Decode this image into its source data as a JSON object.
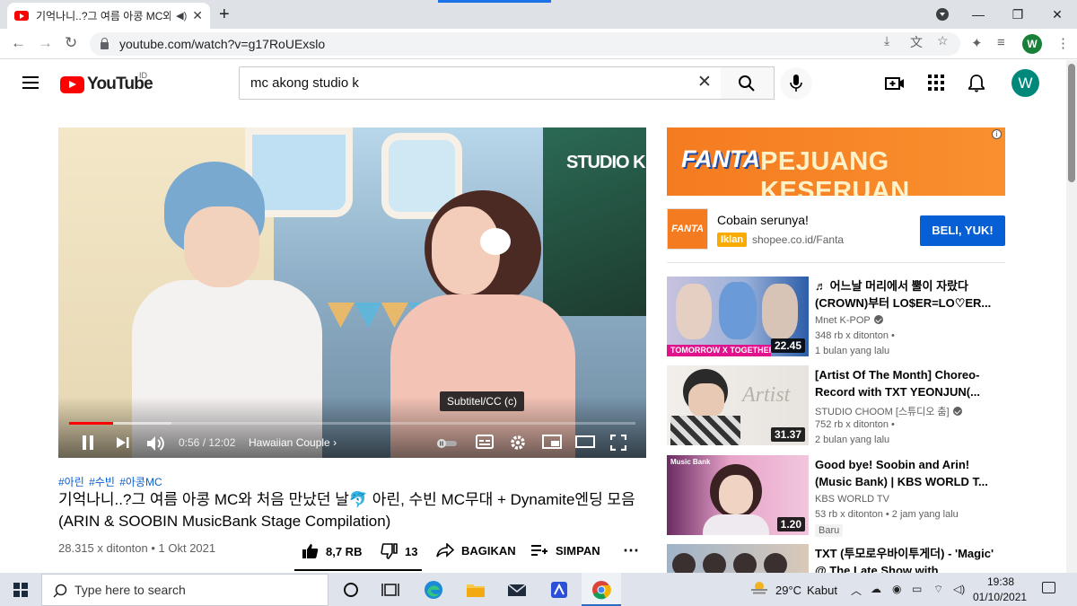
{
  "browser": {
    "tab_title": "기억나니..?그 여름 아콩 MC와 처음 만났던 날",
    "new_tab_symbol": "+",
    "url": "youtube.com/watch?v=g17RoUExslo",
    "profile_initial": "W",
    "window_controls": {
      "minimize": "—",
      "restore": "❐",
      "close": "✕"
    }
  },
  "masthead": {
    "logo_text": "YouTube",
    "country_code": "ID",
    "search_query": "mc akong studio k",
    "avatar_initial": "W"
  },
  "player": {
    "overlay_logo": "STUDIO K",
    "tooltip": "Subtitel/CC (c)",
    "time_current": "0:56",
    "time_total": "12:02",
    "time_display": "0:56 / 12:02",
    "chapter": "Hawaiian Couple",
    "progress_played": 0.078,
    "progress_loaded": 0.18
  },
  "video": {
    "hashtags": [
      "#아린",
      "#수빈",
      "#아콩MC"
    ],
    "title": "기억나니..?그 여름 아콩 MC와 처음 만났던 날🐬 아린, 수빈 MC무대 + Dynamite엔딩 모음(ARIN & SOOBIN MusicBank Stage Compilation)",
    "views": "28.315 x ditonton",
    "date": "1 Okt 2021",
    "view_info": "28.315 x ditonton • 1 Okt 2021",
    "actions": {
      "like": "8,7 RB",
      "dislike": "13",
      "share": "BAGIKAN",
      "save": "SIMPAN"
    }
  },
  "ad": {
    "banner_brand": "FANTA",
    "banner_slogan": "PEJUANG KESERUAN",
    "logo_text": "FANTA",
    "headline": "Cobain serunya!",
    "badge": "Iklan",
    "domain": "shopee.co.id/Fanta",
    "cta": "BELI, YUK!"
  },
  "recommendations": [
    {
      "title": "♬ 어느날 머리에서 뿔이 자랐다 (CROWN)부터 LO$ER=LO♡ER...",
      "channel": "Mnet K-POP",
      "verified": true,
      "views": "348 rb x ditonton •",
      "age": "1 bulan yang lalu",
      "duration": "22.45",
      "thumb_caption": "TOMORROW X TOGETHER",
      "thumb_colors": [
        "#c8c2de",
        "#2b5da8"
      ]
    },
    {
      "title": "[Artist Of The Month] Choreo-Record with TXT YEONJUN(...",
      "channel": "STUDIO CHOOM [스튜디오 춤]",
      "verified": true,
      "views": "752 rb x ditonton •",
      "age": "2 bulan yang lalu",
      "duration": "31.37",
      "thumb_caption": "Artist",
      "thumb_colors": [
        "#e7e3de",
        "#2a2a2a"
      ]
    },
    {
      "title": "Good bye! Soobin and Arin! (Music Bank) | KBS WORLD T...",
      "channel": "KBS WORLD TV",
      "verified": false,
      "views_age": "53 rb x ditonton • 2 jam yang lalu",
      "badge": "Baru",
      "duration": "1.20",
      "thumb_caption": "Music Bank",
      "thumb_colors": [
        "#e8a4c9",
        "#6a2b62"
      ]
    },
    {
      "title": "TXT (투모로우바이투게더) - 'Magic' @ The Late Show with...",
      "thumb_colors": [
        "#9fb3c8",
        "#d9c9b9"
      ]
    }
  ],
  "taskbar": {
    "search_placeholder": "Type here to search",
    "temperature": "29°C",
    "weather": "Kabut",
    "time": "19:38",
    "date": "01/10/2021"
  }
}
